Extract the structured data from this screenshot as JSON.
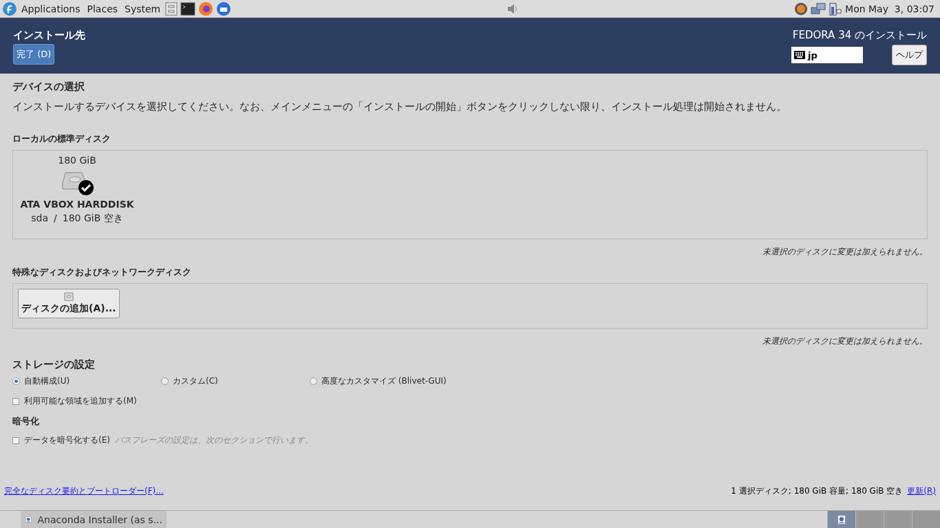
{
  "top_panel": {
    "menus": [
      "Applications",
      "Places",
      "System"
    ],
    "clock": "Mon May  3, 03:07"
  },
  "header": {
    "title": "インストール先",
    "done_button": "完了 (D)",
    "product": "FEDORA 34 のインストール",
    "keyboard_layout": "jp",
    "help_button": "ヘルプ"
  },
  "device_selection": {
    "heading": "デバイスの選択",
    "description": "インストールするデバイスを選択してください。なお、メインメニューの「インストールの開始」ボタンをクリックしない限り、インストール処理は開始されません。"
  },
  "local_disks": {
    "heading": "ローカルの標準ディスク",
    "disks": [
      {
        "size": "180 GiB",
        "model": "ATA VBOX HARDDISK",
        "device": "sda",
        "separator": "/",
        "free": "180 GiB 空き",
        "selected": true
      }
    ],
    "note": "未選択のディスクに変更は加えられません。"
  },
  "special_disks": {
    "heading": "特殊なディスクおよびネットワークディスク",
    "add_button": "ディスクの追加(A)...",
    "note": "未選択のディスクに変更は加えられません。"
  },
  "storage": {
    "heading": "ストレージの設定",
    "options": [
      {
        "label": "自動構成(U)",
        "selected": true
      },
      {
        "label": "カスタム(C)",
        "selected": false
      },
      {
        "label": "高度なカスタマイズ (Blivet-GUI)",
        "selected": false
      }
    ],
    "reclaim": {
      "label": "利用可能な領域を追加する(M)",
      "checked": false
    }
  },
  "encryption": {
    "heading": "暗号化",
    "checkbox": {
      "label": "データを暗号化する(E)",
      "checked": false
    },
    "hint": "パスフレーズの設定は、次のセクションで行います。"
  },
  "footer": {
    "summary_link": "完全なディスク要約とブートローダー(F)...",
    "status": "1 選択ディスク; 180 GiB 容量; 180 GiB 空き",
    "refresh_link": "更新(R)"
  },
  "taskbar": {
    "task": "Anaconda Installer (as s...",
    "workspaces": [
      {
        "selected": true
      },
      {
        "selected": false
      },
      {
        "selected": false
      },
      {
        "selected": false
      }
    ]
  }
}
